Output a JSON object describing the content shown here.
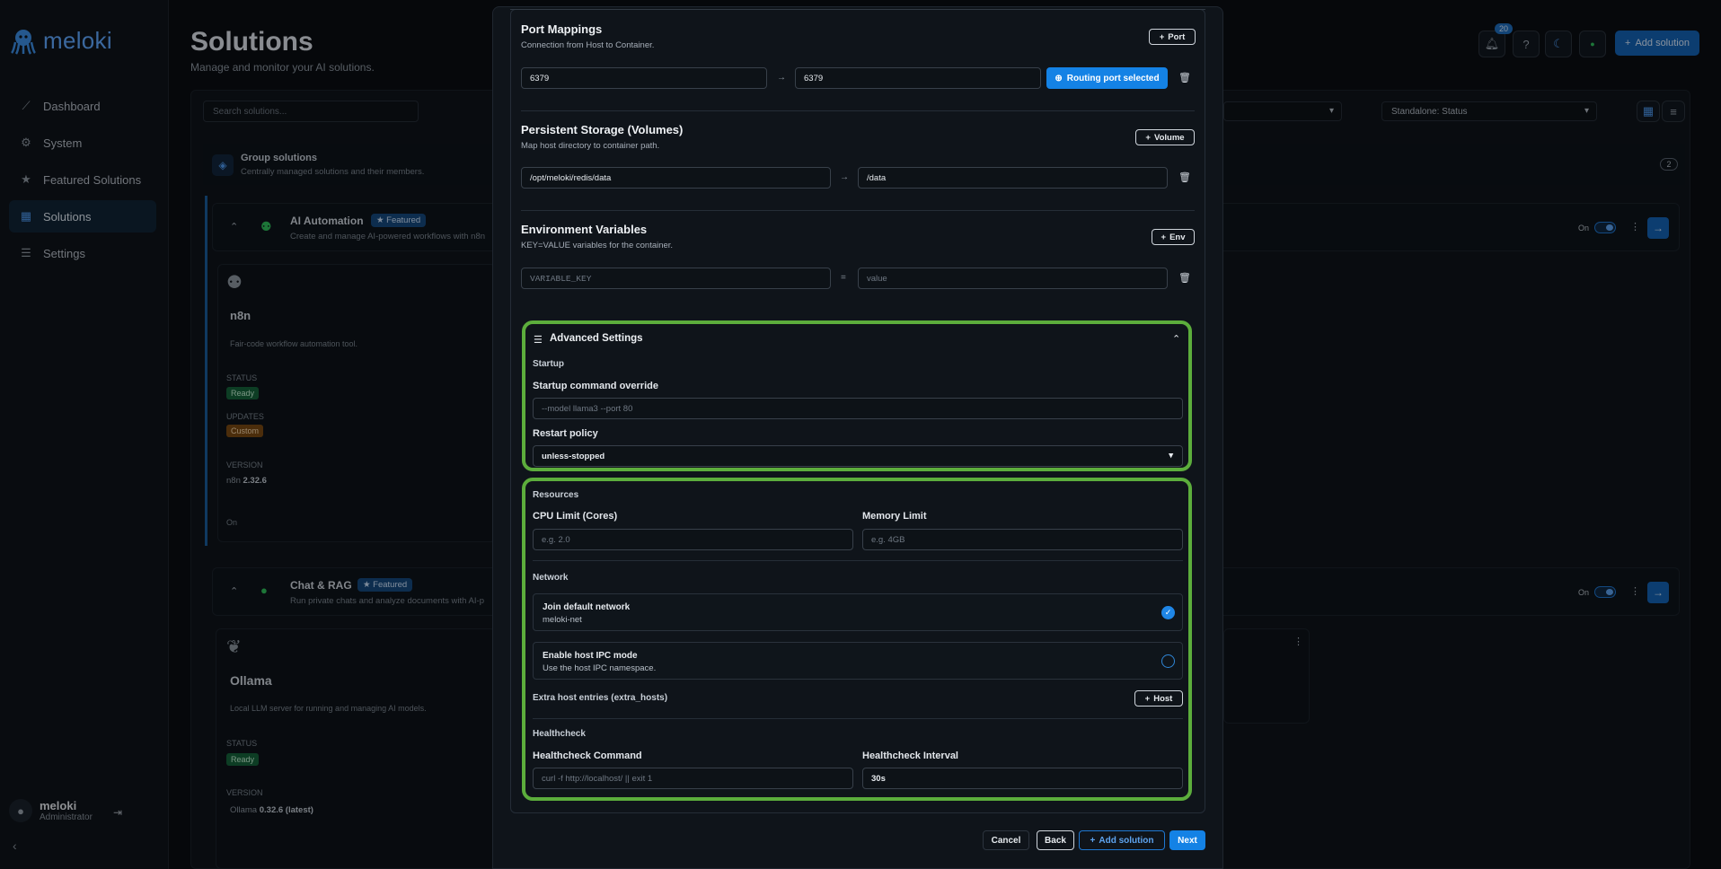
{
  "app": {
    "logo": "meloki"
  },
  "sidebar": {
    "items": [
      {
        "label": "Dashboard",
        "icon": "chart-line-icon"
      },
      {
        "label": "System",
        "icon": "gear-icon"
      },
      {
        "label": "Featured Solutions",
        "icon": "star-icon"
      },
      {
        "label": "Solutions",
        "icon": "grid-icon",
        "active": true
      },
      {
        "label": "Settings",
        "icon": "sliders-icon"
      }
    ],
    "user": {
      "name": "meloki",
      "role": "Administrator"
    }
  },
  "header": {
    "title": "Solutions",
    "subtitle": "Manage and monitor your AI solutions.",
    "notifications_count": "20",
    "add_solution": "Add solution"
  },
  "toolbar": {
    "search_placeholder": "Search solutions...",
    "status_filter": "Standalone: Status"
  },
  "group": {
    "title": "Group solutions",
    "subtitle": "Centrally managed solutions and their members.",
    "count": "2"
  },
  "categories": [
    {
      "title": "AI Automation",
      "badge": "Featured",
      "subtitle": "Create and manage AI-powered workflows with n8n",
      "toggle_label": "On"
    },
    {
      "title": "Chat & RAG",
      "badge": "Featured",
      "subtitle": "Run private chats and analyze documents with AI-p",
      "toggle_label": "On"
    }
  ],
  "cards": [
    {
      "name": "n8n",
      "desc": "Fair-code workflow automation tool.",
      "status_label": "STATUS",
      "status": "Ready",
      "updates_label": "UPDATES",
      "updates": "Custom",
      "version_label": "VERSION",
      "version_app": "n8n",
      "version": "2.32.6",
      "toggle_label": "On"
    },
    {
      "name": "Ollama",
      "desc": "Local LLM server for running and managing AI models.",
      "status_label": "STATUS",
      "status": "Ready",
      "version_label": "VERSION",
      "version_app": "Ollama",
      "version": "0.32.6 (latest)"
    }
  ],
  "modal": {
    "ports": {
      "title": "Port Mappings",
      "subtitle": "Connection from Host to Container.",
      "add": "Port",
      "host": "6379",
      "container": "6379",
      "routing": "Routing port selected"
    },
    "volumes": {
      "title": "Persistent Storage (Volumes)",
      "subtitle": "Map host directory to container path.",
      "add": "Volume",
      "host": "/opt/meloki/redis/data",
      "container": "/data"
    },
    "env": {
      "title": "Environment Variables",
      "subtitle": "KEY=VALUE variables for the container.",
      "add": "Env",
      "key_placeholder": "VARIABLE_KEY",
      "equals": "=",
      "value_placeholder": "value"
    },
    "advanced": {
      "title": "Advanced Settings",
      "startup_heading": "Startup",
      "command_label": "Startup command override",
      "command_placeholder": "--model llama3 --port 80",
      "restart_label": "Restart policy",
      "restart_value": "unless-stopped",
      "resources_heading": "Resources",
      "cpu_label": "CPU Limit (Cores)",
      "cpu_placeholder": "e.g. 2.0",
      "mem_label": "Memory Limit",
      "mem_placeholder": "e.g. 4GB",
      "network_heading": "Network",
      "join_title": "Join default network",
      "join_sub": "meloki-net",
      "join_checked": true,
      "ipc_title": "Enable host IPC mode",
      "ipc_sub": "Use the host IPC namespace.",
      "ipc_checked": false,
      "extra_hosts_label": "Extra host entries (extra_hosts)",
      "add_host": "Host",
      "health_heading": "Healthcheck",
      "health_cmd_label": "Healthcheck Command",
      "health_cmd_placeholder": "curl -f http://localhost/ || exit 1",
      "health_interval_label": "Healthcheck Interval",
      "health_interval_value": "30s"
    },
    "footer": {
      "cancel": "Cancel",
      "back": "Back",
      "add_solution": "Add solution",
      "next": "Next"
    }
  }
}
